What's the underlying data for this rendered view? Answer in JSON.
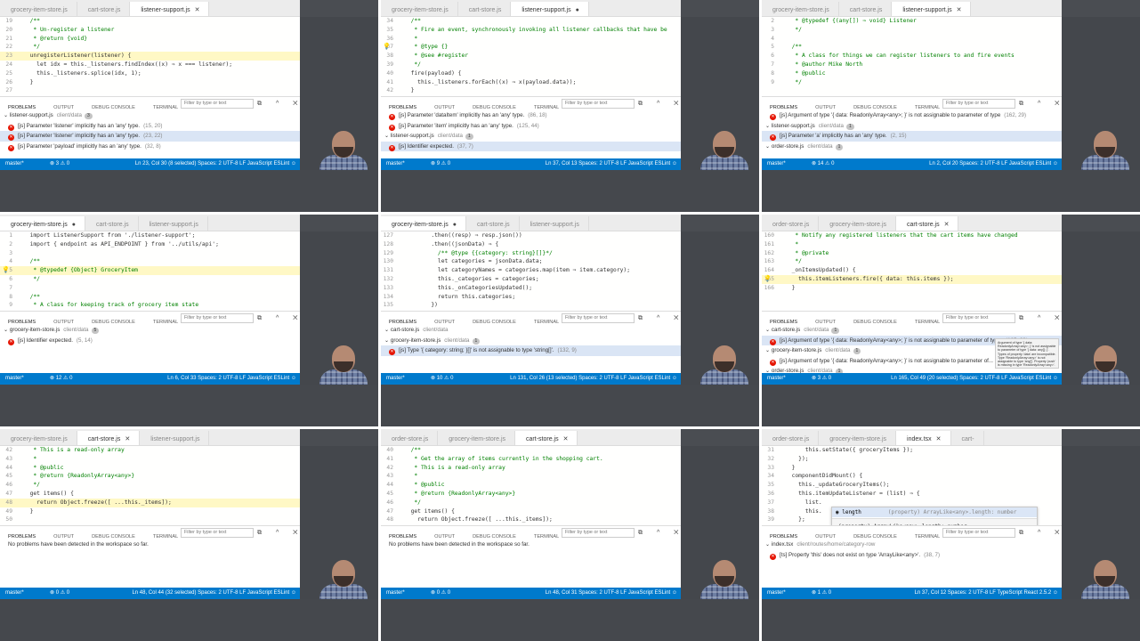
{
  "actions": "⇆ ▶ ⊟ …",
  "panel": {
    "tabs": [
      "PROBLEMS",
      "OUTPUT",
      "DEBUG CONSOLE",
      "TERMINAL"
    ],
    "filter_placeholder": "Filter by type or text",
    "icons": "⧉ ^ ✕"
  },
  "colors": {
    "status_bar": "#007acc",
    "error": "#e51400",
    "selection": "#dae5f5",
    "studio": "#44474c"
  },
  "cells": [
    {
      "tabs": [
        {
          "label": "grocery-item-store.js"
        },
        {
          "label": "cart-store.js"
        },
        {
          "label": "listener-support.js",
          "mark": "✕",
          "active": true
        }
      ],
      "code": [
        {
          "n": "19",
          "t": "  /**"
        },
        {
          "n": "20",
          "t": "   * Un-register a listener"
        },
        {
          "n": "21",
          "t": "   * @return {void}"
        },
        {
          "n": "22",
          "t": "   */"
        },
        {
          "n": "23",
          "t": "  unregisterListener(listener) {",
          "hl": true
        },
        {
          "n": "24",
          "t": "    let idx = this._listeners.findIndex((x) ⇒ x === listener);"
        },
        {
          "n": "25",
          "t": "    this._listeners.splice(idx, 1);"
        },
        {
          "n": "26",
          "t": "  }"
        },
        {
          "n": "27",
          "t": ""
        }
      ],
      "problems": [
        {
          "text": "listener-support.js",
          "dim": "client/data",
          "count": "3",
          "fold": true
        },
        {
          "text": "[js] Parameter 'listener' implicitly has an 'any' type.",
          "dim": "(15, 20)"
        },
        {
          "text": "[js] Parameter 'listener' implicitly has an 'any' type.",
          "dim": "(23, 22)",
          "sel": true
        },
        {
          "text": "[js] Parameter 'payload' implicitly has an 'any' type.",
          "dim": "(32, 8)"
        }
      ],
      "status": {
        "branch": "master*",
        "problems": "⊗ 3 ⚠ 0",
        "right": "Ln 23, Col 30 (8 selected)   Spaces: 2   UTF-8   LF   JavaScript   ESLint   ☺"
      }
    },
    {
      "tabs": [
        {
          "label": "grocery-item-store.js"
        },
        {
          "label": "cart-store.js"
        },
        {
          "label": "listener-support.js",
          "mark": "●",
          "active": true
        }
      ],
      "code": [
        {
          "n": "34",
          "t": "  /**"
        },
        {
          "n": "35",
          "t": "   * Fire an event, synchronously invoking all listener callbacks that have be"
        },
        {
          "n": "36",
          "t": "   *"
        },
        {
          "n": "37",
          "t": "   * @type {}",
          "bulb": true
        },
        {
          "n": "38",
          "t": "   * @see #register"
        },
        {
          "n": "39",
          "t": "   */"
        },
        {
          "n": "40",
          "t": "  fire(payload) {"
        },
        {
          "n": "41",
          "t": "    this._listeners.forEach((x) ⇒ x(payload.data));"
        },
        {
          "n": "42",
          "t": "  }"
        }
      ],
      "problems": [
        {
          "text": "[js] Parameter 'dataItem' implicitly has an 'any' type.",
          "dim": "(86, 18)"
        },
        {
          "text": "[js] Parameter 'item' implicitly has an 'any' type.",
          "dim": "(125, 44)"
        },
        {
          "text": "listener-support.js",
          "dim": "client/data",
          "count": "1",
          "fold": true
        },
        {
          "text": "[js] Identifier expected.",
          "dim": "(37, 7)",
          "sel": true
        }
      ],
      "status": {
        "branch": "master*",
        "problems": "⊗ 9 ⚠ 0",
        "right": "Ln 37, Col 13   Spaces: 2   UTF-8   LF   JavaScript   ESLint   ☺"
      }
    },
    {
      "tabs": [
        {
          "label": "grocery-item-store.js"
        },
        {
          "label": "cart-store.js"
        },
        {
          "label": "listener-support.js",
          "mark": "✕",
          "active": true
        }
      ],
      "code": [
        {
          "n": "2",
          "t": "   * @typedef {(any[]) ⇒ void} Listener"
        },
        {
          "n": "3",
          "t": "   */"
        },
        {
          "n": "4",
          "t": ""
        },
        {
          "n": "5",
          "t": "  /**"
        },
        {
          "n": "6",
          "t": "   * A class for things we can register listeners to and fire events"
        },
        {
          "n": "7",
          "t": "   * @author Mike North"
        },
        {
          "n": "8",
          "t": "   * @public"
        },
        {
          "n": "9",
          "t": "   */"
        }
      ],
      "problems": [
        {
          "text": "[js] Argument of type '{ data: ReadonlyArray<any>; }' is not assignable to parameter of type",
          "dim": "(162, 29)"
        },
        {
          "text": "listener-support.js",
          "dim": "client/data",
          "count": "1",
          "fold": true
        },
        {
          "text": "[js] Parameter 'a' implicitly has an 'any' type.",
          "dim": "(2, 15)",
          "sel": true
        },
        {
          "text": "order-store.js",
          "dim": "client/data",
          "count": "1",
          "fold": true
        }
      ],
      "status": {
        "branch": "master*",
        "problems": "⊗ 14 ⚠ 0",
        "right": "Ln 2, Col 20   Spaces: 2   UTF-8   LF   JavaScript   ESLint   ☺"
      }
    },
    {
      "tabs": [
        {
          "label": "grocery-item-store.js",
          "mark": "●",
          "active": true
        },
        {
          "label": "cart-store.js"
        },
        {
          "label": "listener-support.js"
        }
      ],
      "code": [
        {
          "n": "1",
          "t": "  import ListenerSupport from './listener-support';"
        },
        {
          "n": "2",
          "t": "  import { endpoint as API_ENDPOINT } from '../utils/api';"
        },
        {
          "n": "3",
          "t": ""
        },
        {
          "n": "4",
          "t": "  /**"
        },
        {
          "n": "5",
          "t": "   * @typedef {Object} GroceryItem",
          "bulb": true,
          "hl": true
        },
        {
          "n": "6",
          "t": "   */"
        },
        {
          "n": "7",
          "t": ""
        },
        {
          "n": "8",
          "t": "  /**"
        },
        {
          "n": "9",
          "t": "   * A class for keeping track of grocery item state"
        },
        {
          "n": "10",
          "t": "   * @public"
        },
        {
          "n": "11",
          "t": "   */"
        }
      ],
      "problems": [
        {
          "text": "grocery-item-store.js",
          "dim": "client/data",
          "count": "5",
          "fold": true
        },
        {
          "text": "[js] Identifier expected.",
          "dim": "(5, 14)"
        }
      ],
      "status": {
        "branch": "master*",
        "problems": "⊗ 12 ⚠ 0",
        "right": "Ln 6, Col 33   Spaces: 2   UTF-8   LF   JavaScript   ESLint   ☺"
      }
    },
    {
      "tabs": [
        {
          "label": "grocery-item-store.js",
          "mark": "●",
          "active": true
        },
        {
          "label": "cart-store.js"
        },
        {
          "label": "listener-support.js"
        }
      ],
      "code": [
        {
          "n": "127",
          "t": "        .then((resp) ⇒ resp.json())"
        },
        {
          "n": "128",
          "t": "        .then((jsonData) ⇒ {"
        },
        {
          "n": "129",
          "t": "          /** @type {{category: string}[]}*/"
        },
        {
          "n": "130",
          "t": "          let categories = jsonData.data;"
        },
        {
          "n": "131",
          "t": "          let categoryNames = categories.map(item ⇒ item.category);"
        },
        {
          "n": "132",
          "t": "          this._categories = categories;"
        },
        {
          "n": "133",
          "t": "          this._onCategoriesUpdated();"
        },
        {
          "n": "134",
          "t": "          return this.categories;"
        },
        {
          "n": "135",
          "t": "        })"
        },
        {
          "n": "136",
          "t": "        .catch((err) ⇒ {"
        },
        {
          "n": "137",
          "t": "          console.error('Error updating categories', err);"
        }
      ],
      "problems": [
        {
          "text": "cart-store.js",
          "dim": "client/data",
          "fold": true
        },
        {
          "text": "grocery-item-store.js",
          "dim": "client/data",
          "count": "1",
          "fold": true
        },
        {
          "text": "[js] Type '{ category: string; }[]' is not assignable to type 'string[]'.",
          "dim": "(132, 9)",
          "sel": true
        }
      ],
      "status": {
        "branch": "master*",
        "problems": "⊗ 10 ⚠ 0",
        "right": "Ln 131, Col 26 (13 selected)   Spaces: 2   UTF-8   LF   JavaScript   ESLint   ☺"
      }
    },
    {
      "tabs": [
        {
          "label": "order-store.js"
        },
        {
          "label": "grocery-item-store.js"
        },
        {
          "label": "cart-store.js",
          "mark": "✕",
          "active": true
        }
      ],
      "code": [
        {
          "n": "160",
          "t": "   * Notify any registered listeners that the cart items have changed"
        },
        {
          "n": "161",
          "t": "   *"
        },
        {
          "n": "162",
          "t": "   * @private"
        },
        {
          "n": "163",
          "t": "   */"
        },
        {
          "n": "164",
          "t": "  _onItemsUpdated() {"
        },
        {
          "n": "165",
          "t": "    this.itemListeners.fire({ data: this.items });",
          "bulb": true,
          "hl": true
        },
        {
          "n": "166",
          "t": "  }"
        }
      ],
      "problems": [
        {
          "text": "cart-store.js",
          "dim": "client/data",
          "count": "1",
          "fold": true
        },
        {
          "text": "[js] Argument of type '{ data: ReadonlyArray<any>; }' is not assignable to parameter of typ...",
          "dim": "(165, 29)",
          "sel": true
        },
        {
          "text": "grocery-item-store.js",
          "dim": "client/data",
          "count": "1",
          "fold": true
        },
        {
          "text": "[js] Argument of type '{ data: ReadonlyArray<any>; }' is not assignable to parameter of...",
          "dim": "(28, 41)"
        },
        {
          "text": "order-store.js",
          "dim": "client/data",
          "count": "1",
          "fold": true
        },
        {
          "text": "[js] Argument of type '{ data: ReadonlyArray<any>; }' is not assignable to ...",
          "dim": "(64, 30)"
        }
      ],
      "tooltip": "Argument of type '{ data: ReadonlyArray<any>; }' is not assignable to parameter of type '{ data: any[]; }'. Types of property 'data' are incompatible. Type 'ReadonlyArray<any>' is not assignable to type 'any[]'. Property 'push' is missing in type 'ReadonlyArray<any>'.",
      "status": {
        "branch": "master*",
        "problems": "⊗ 3 ⚠ 0",
        "right": "Ln 165, Col 49 (20 selected)   Spaces: 2   UTF-8   LF   JavaScript   ESLint   ☺"
      }
    },
    {
      "tabs": [
        {
          "label": "grocery-item-store.js"
        },
        {
          "label": "cart-store.js",
          "mark": "✕",
          "active": true
        },
        {
          "label": "listener-support.js"
        }
      ],
      "code": [
        {
          "n": "42",
          "t": "   * This is a read-only array"
        },
        {
          "n": "43",
          "t": "   *"
        },
        {
          "n": "44",
          "t": "   * @public"
        },
        {
          "n": "45",
          "t": "   * @return {ReadonlyArray<any>}"
        },
        {
          "n": "46",
          "t": "   */"
        },
        {
          "n": "47",
          "t": "  get items() {"
        },
        {
          "n": "48",
          "t": "    return Object.freeze([ ...this._items]);",
          "hl": true
        },
        {
          "n": "49",
          "t": "  }"
        },
        {
          "n": "50",
          "t": ""
        },
        {
          "n": "51",
          "t": "  /**"
        },
        {
          "n": "52",
          "t": "   * Get the \"initial\" contents of the cart."
        }
      ],
      "problems": [
        {
          "text": "No problems have been detected in the workspace so far.",
          "plain": true
        }
      ],
      "status": {
        "branch": "master*",
        "problems": "⊗ 0 ⚠ 0",
        "right": "Ln 48, Col 44 (32 selected)   Spaces: 2   UTF-8   LF   JavaScript   ESLint   ☺"
      }
    },
    {
      "tabs": [
        {
          "label": "order-store.js"
        },
        {
          "label": "grocery-item-store.js"
        },
        {
          "label": "cart-store.js",
          "mark": "✕",
          "active": true
        }
      ],
      "code": [
        {
          "n": "40",
          "t": "  /**"
        },
        {
          "n": "41",
          "t": "   * Get the array of items currently in the shopping cart."
        },
        {
          "n": "42",
          "t": "   * This is a read-only array"
        },
        {
          "n": "43",
          "t": "   *"
        },
        {
          "n": "44",
          "t": "   * @public"
        },
        {
          "n": "45",
          "t": "   * @return {ReadonlyArray<any>}"
        },
        {
          "n": "46",
          "t": "   */"
        },
        {
          "n": "47",
          "t": "  get items() {"
        },
        {
          "n": "48",
          "t": "    return Object.freeze([ ...this._items]);"
        },
        {
          "n": "49",
          "t": "  }"
        }
      ],
      "problems": [
        {
          "text": "No problems have been detected in the workspace so far.",
          "plain": true
        }
      ],
      "status": {
        "branch": "master*",
        "problems": "⊗ 0 ⚠ 0",
        "right": "Ln 48, Col 31   Spaces: 2   UTF-8   LF   JavaScript   ESLint   ☺"
      }
    },
    {
      "tabs": [
        {
          "label": "order-store.js"
        },
        {
          "label": "grocery-item-store.js"
        },
        {
          "label": "index.tsx",
          "mark": "✕",
          "active": true
        },
        {
          "label": "cart-"
        }
      ],
      "code": [
        {
          "n": "31",
          "t": "      this.setState({ groceryItems });"
        },
        {
          "n": "32",
          "t": "    });"
        },
        {
          "n": "33",
          "t": "  }"
        },
        {
          "n": "34",
          "t": "  componentDidMount() {"
        },
        {
          "n": "35",
          "t": "    this._updateGroceryItems();"
        },
        {
          "n": "36",
          "t": "    this.itemUpdateListener = (list) ⇒ {"
        },
        {
          "n": "37",
          "t": "      list."
        },
        {
          "n": "38",
          "t": "      this."
        },
        {
          "n": "39",
          "t": "    };"
        },
        {
          "n": "40",
          "t": "    this.props.groceryItemStore.registerListener(this.itemUpdate"
        },
        {
          "n": "41",
          "t": "    this.props.groceryItemStore.updateItemsForCategory(this.props.categoryNam"
        }
      ],
      "suggest": {
        "item": "◉ length",
        "detail": "(property) ArrayLike<any>.length: number",
        "doc": "(property) ArrayLike<any>.length: number"
      },
      "problems": [
        {
          "text": "index.tsx",
          "dim": "client/routes/home/category-row",
          "fold": true
        },
        {
          "text": "[ts] Property 'this' does not exist on type 'ArrayLike<any>'.",
          "dim": "(38, 7)"
        }
      ],
      "status": {
        "branch": "master*",
        "problems": "⊗ 1 ⚠ 0",
        "right": "Ln 37, Col 12   Spaces: 2   UTF-8   LF   TypeScript React   2.5.2   ☺"
      }
    }
  ]
}
